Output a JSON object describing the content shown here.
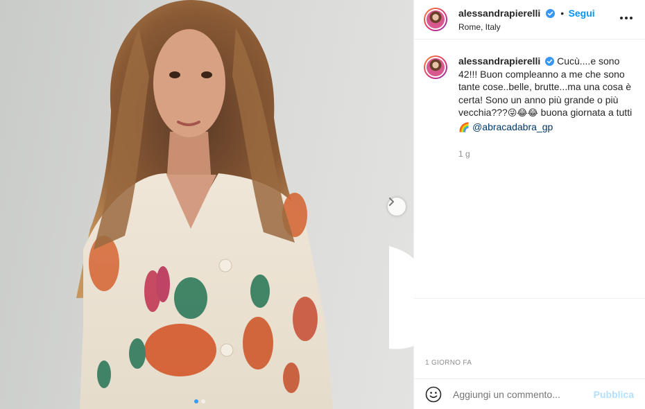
{
  "post": {
    "username": "alessandrapierelli",
    "separator": "•",
    "follow_label": "Segui",
    "location": "Rome, Italy",
    "verified_icon": "verified-badge-icon",
    "caption": "Cucù....e sono 42!!! Buon compleanno a me che sono tante cose..belle, brutte...ma una cosa è certa! Sono un anno più grande o più vecchia???",
    "caption_emojis": "😜😂😂",
    "caption_tail": " buona giornata a tutti ",
    "rainbow_emoji": "🌈",
    "mention": "@abracadabra_gp",
    "comment_age": "1 g",
    "posted_time": "1 GIORNO FA",
    "carousel": {
      "slide_count": 2,
      "active_index": 0
    }
  },
  "comment_box": {
    "placeholder": "Aggiungi un commento...",
    "publish_label": "Pubblica",
    "emoji_icon": "smiley-icon"
  },
  "colors": {
    "accent": "#0095f6",
    "publish_disabled": "#b2dffc",
    "mention": "#00376b",
    "muted": "#8e8e8e"
  }
}
